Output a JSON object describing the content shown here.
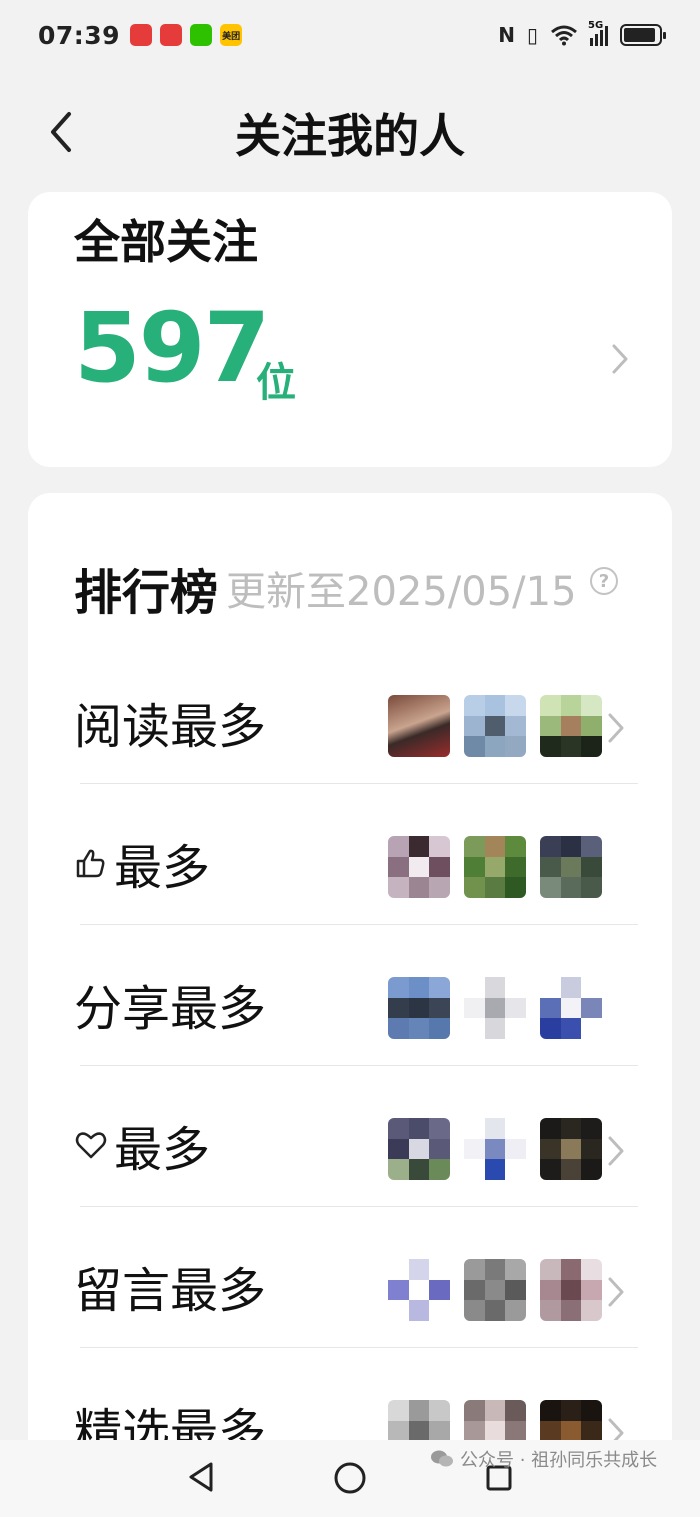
{
  "status_bar": {
    "time": "07:39",
    "app_icons": [
      {
        "name": "huawei-app-icon",
        "color": "#e63b3b",
        "text": ""
      },
      {
        "name": "huawei-app-icon-2",
        "color": "#e63b3b",
        "text": ""
      },
      {
        "name": "wechat-app-icon",
        "color": "#2dc100",
        "text": ""
      },
      {
        "name": "meituan-app-icon",
        "color": "#ffc300",
        "text": "美团"
      }
    ],
    "network": "5G",
    "battery_level": 0.9
  },
  "header": {
    "title": "关注我的人",
    "back_icon": "chevron-left-icon"
  },
  "total": {
    "label": "全部关注",
    "count": "597",
    "unit": "位",
    "accent_color": "#27b07a"
  },
  "ranking": {
    "title": "排行榜",
    "update_text": "更新至2025/05/15",
    "help_symbol": "?",
    "rows": [
      {
        "label": "阅读最多",
        "icon": null,
        "show_chevron": true
      },
      {
        "label": "最多",
        "icon": "thumbs-up-icon",
        "show_chevron": false
      },
      {
        "label": "分享最多",
        "icon": null,
        "show_chevron": false
      },
      {
        "label": "最多",
        "icon": "heart-icon",
        "show_chevron": true
      },
      {
        "label": "留言最多",
        "icon": null,
        "show_chevron": true
      },
      {
        "label": "精选最多",
        "icon": null,
        "show_chevron": true
      }
    ]
  },
  "nav_bar": {
    "back_icon": "triangle-back-icon",
    "home_icon": "circle-home-icon",
    "recent_icon": "square-recent-icon"
  },
  "watermark": {
    "text": "公众号 · 祖孙同乐共成长"
  }
}
